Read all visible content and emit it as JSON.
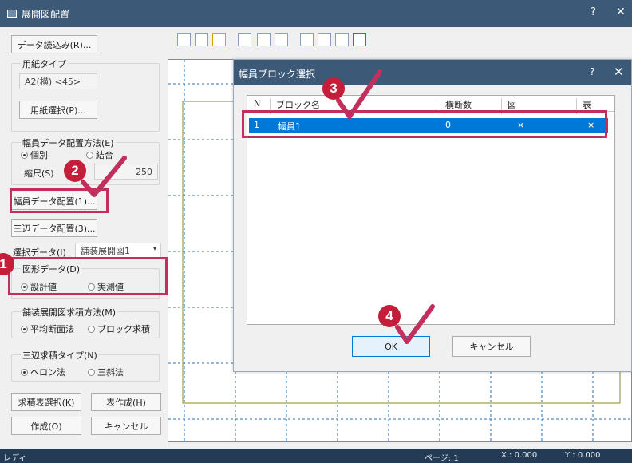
{
  "window": {
    "title": "展開図配置",
    "help": "?",
    "close": "✕"
  },
  "left": {
    "read_data_button": "データ読込み(R)...",
    "paper_type_group": "用紙タイプ",
    "paper_type_value": "A2(横) <45>",
    "paper_select_button": "用紙選択(P)...",
    "width_method_group": "幅員データ配置方法(E)",
    "radio_individual": "個別",
    "radio_combined": "結合",
    "scale_label": "縮尺(S)",
    "scale_value": "250",
    "width_place_button": "幅員データ配置(1)...",
    "tri_place_button": "三辺データ配置(3)...",
    "select_data_label": "選択データ(I)",
    "select_data_value": "舗装展開図1",
    "shape_group": "図形データ(D)",
    "radio_design": "設計値",
    "radio_measured": "実測値",
    "area_method_group": "舗装展開図求積方法(M)",
    "radio_avg": "平均断面法",
    "radio_block": "ブロック求積",
    "tri_type_group": "三辺求積タイプ(N)",
    "radio_heron": "ヘロン法",
    "radio_slope": "三斜法",
    "area_table_button": "求積表選択(K)",
    "table_create_button": "表作成(H)",
    "create_button": "作成(O)",
    "cancel_button": "キャンセル"
  },
  "dialog": {
    "title": "幅員ブロック選択",
    "help": "?",
    "close": "✕",
    "columns": [
      "N",
      "ブロック名",
      "横断数",
      "図",
      "表"
    ],
    "rows": [
      {
        "n": "1",
        "name": "幅員1",
        "count": "0",
        "fig": "×",
        "table": "×"
      }
    ],
    "ok": "OK",
    "cancel": "キャンセル"
  },
  "badges": [
    "1",
    "2",
    "3",
    "4"
  ],
  "status": {
    "ready": "レディ",
    "page": "ページ: 1",
    "x": "X : 0.000",
    "y": "Y : 0.000"
  },
  "colors": {
    "titlebar": "#3c5a78",
    "accent": "#c32f5c",
    "badge": "#c41e3a",
    "selection": "#0078d7"
  }
}
